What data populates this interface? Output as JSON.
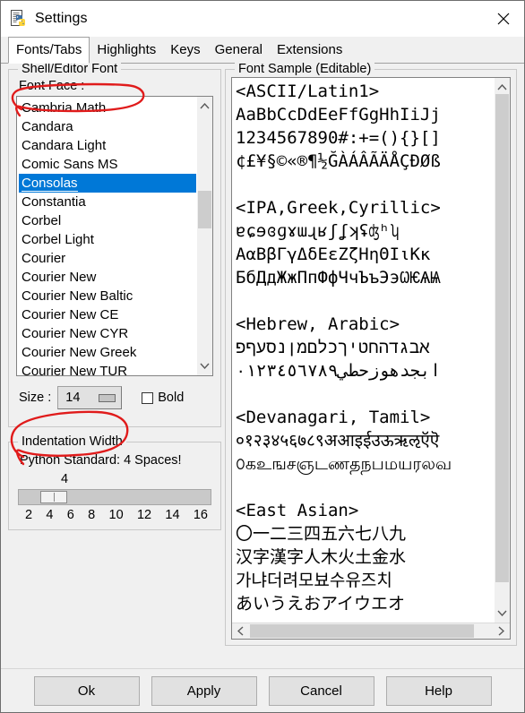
{
  "window": {
    "title": "Settings",
    "app_icon": "idle-python-document-icon",
    "close_icon": "close-icon"
  },
  "tabs": [
    {
      "label": "Fonts/Tabs",
      "active": true
    },
    {
      "label": "Highlights",
      "active": false
    },
    {
      "label": "Keys",
      "active": false
    },
    {
      "label": "General",
      "active": false
    },
    {
      "label": "Extensions",
      "active": false
    }
  ],
  "shell_editor_font": {
    "group_title": "Shell/Editor Font",
    "font_face_label": "Font Face :",
    "font_list": [
      "Cambria Math",
      "Candara",
      "Candara Light",
      "Comic Sans MS",
      "Consolas",
      "Constantia",
      "Corbel",
      "Corbel Light",
      "Courier",
      "Courier New",
      "Courier New Baltic",
      "Courier New CE",
      "Courier New CYR",
      "Courier New Greek",
      "Courier New TUR"
    ],
    "selected_font": "Consolas",
    "size_label": "Size :",
    "size_value": "14",
    "bold_label": "Bold",
    "bold_checked": false,
    "scroll_up_icon": "chevron-up-icon",
    "scroll_down_icon": "chevron-down-icon"
  },
  "indentation": {
    "group_title": "Indentation Width",
    "note": "Python Standard: 4 Spaces!",
    "value": "4",
    "ticks": [
      "2",
      "4",
      "6",
      "8",
      "10",
      "12",
      "14",
      "16"
    ]
  },
  "font_sample": {
    "group_title": "Font Sample (Editable)",
    "text": "<ASCII/Latin1>\nAaBbCcDdEeFfGgHhIiJj\n1234567890#:+=(){}[]\n¢£¥§©«®¶½ĞÀÁÂÃÄÅÇÐØß\n\n<IPA,Greek,Cyrillic>\nɐɕɘɞɡɤɯɻʁʃʆʞʢʤʰʮ\nАαΒβΓγΔδΕεΖζΗηΘΙιΚκ\nБбДдЖжПпФфЧчЪъЭэѠѤѦѨ\n\n<Hebrew, Arabic>\nאבגדהחטיךכלםמןנסעףפ\nابجدهوزحطي٠١٢٣٤٥٦٧٨٩\n\n<Devanagari, Tamil>\n०१२३४५६७८९अआइईउऊऋऌऍऎ\n௦கஉஙசஞடணதநபமயரலவ\n\n<East Asian>\n〇一二三四五六七八九\n汉字漢字人木火土金水\n가냐더려모뵤수유즈치\nあいうえおアイウエオ",
    "vscroll_up_icon": "chevron-up-icon",
    "vscroll_down_icon": "chevron-down-icon",
    "hscroll_left_icon": "chevron-left-icon",
    "hscroll_right_icon": "chevron-right-icon"
  },
  "footer_buttons": [
    {
      "label": "Ok"
    },
    {
      "label": "Apply"
    },
    {
      "label": "Cancel"
    },
    {
      "label": "Help"
    }
  ],
  "annotations": {
    "color": "#e01b1b",
    "marks": [
      {
        "name": "font-face-circle",
        "target": "Font Face :"
      },
      {
        "name": "size-circle",
        "target": "Size : 14"
      }
    ]
  }
}
